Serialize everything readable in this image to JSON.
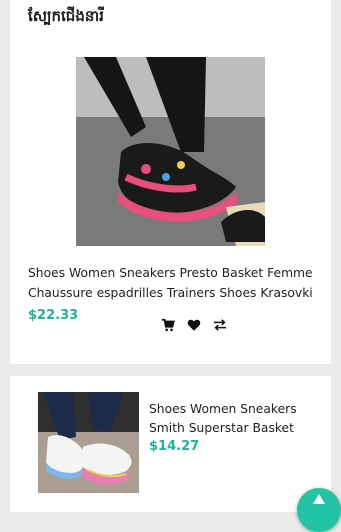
{
  "section": {
    "title": "ស្បែកជើងនារី"
  },
  "products": [
    {
      "title": "Shoes Women Sneakers Presto Basket Femme Chaussure espadrilles Trainers Shoes Krasovki",
      "price": "$22.33"
    },
    {
      "title": "Shoes Women Sneakers Smith Superstar Basket",
      "price": "$14.27"
    }
  ],
  "actions": {
    "cart_icon": "cart-icon",
    "wishlist_icon": "heart-icon",
    "compare_icon": "compare-icon"
  },
  "colors": {
    "price": "#20b2a0",
    "fab": "#22c4a5",
    "background": "#ebebeb"
  }
}
